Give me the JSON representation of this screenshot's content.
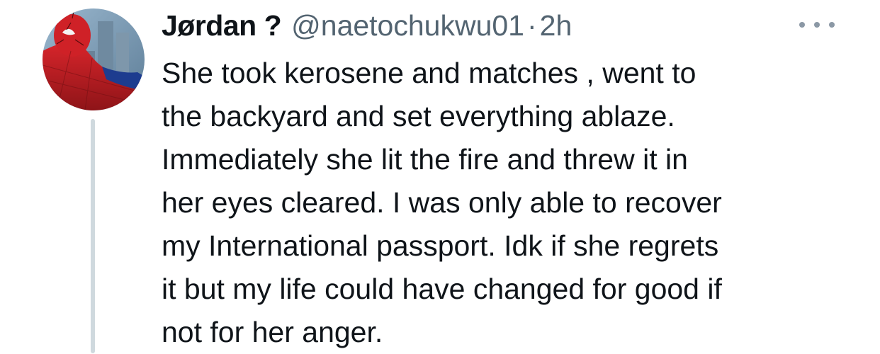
{
  "tweet": {
    "author": {
      "display_name": "Jørdan ?",
      "handle": "@naetochukwu01",
      "avatar_icon": "spiderman-avatar"
    },
    "separator": "·",
    "timestamp": "2h",
    "more_icon": "more-options-icon",
    "text_lines": [
      "She took kerosene and matches , went to",
      "the backyard and set everything ablaze.",
      "Immediately she lit the fire and threw it in",
      "her eyes cleared. I was only able to recover",
      "my International passport. Idk if she regrets",
      "it but my life could have changed for good if",
      "not for her anger."
    ]
  },
  "colors": {
    "text": "#0f1419",
    "secondary": "#536471",
    "thread_line": "#cfd9de",
    "background": "#ffffff"
  }
}
